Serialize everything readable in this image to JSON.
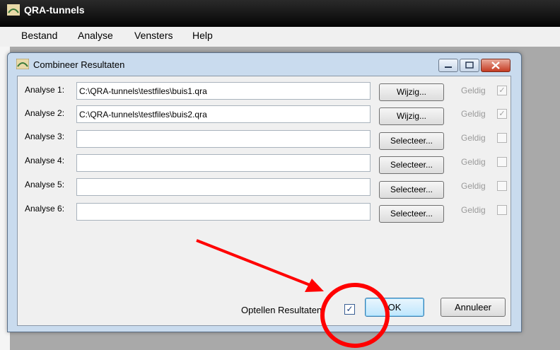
{
  "app": {
    "title": "QRA-tunnels"
  },
  "menu": [
    "Bestand",
    "Analyse",
    "Vensters",
    "Help"
  ],
  "dialog": {
    "title": "Combineer Resultaten",
    "rows": [
      {
        "label": "Analyse 1:",
        "value": "C:\\QRA-tunnels\\testfiles\\buis1.qra",
        "button": "Wijzig...",
        "status": "Geldig",
        "checked": "✓"
      },
      {
        "label": "Analyse 2:",
        "value": "C:\\QRA-tunnels\\testfiles\\buis2.qra",
        "button": "Wijzig...",
        "status": "Geldig",
        "checked": "✓"
      },
      {
        "label": "Analyse 3:",
        "value": "",
        "button": "Selecteer...",
        "status": "Geldig",
        "checked": ""
      },
      {
        "label": "Analyse 4:",
        "value": "",
        "button": "Selecteer...",
        "status": "Geldig",
        "checked": ""
      },
      {
        "label": "Analyse 5:",
        "value": "",
        "button": "Selecteer...",
        "status": "Geldig",
        "checked": ""
      },
      {
        "label": "Analyse 6:",
        "value": "",
        "button": "Selecteer...",
        "status": "Geldig",
        "checked": ""
      }
    ],
    "optellen_label": "Optellen Resultaten",
    "optellen_checked": "✓",
    "ok_label": "OK",
    "cancel_label": "Annuleer"
  },
  "annotation": {
    "color": "#ff0000"
  }
}
